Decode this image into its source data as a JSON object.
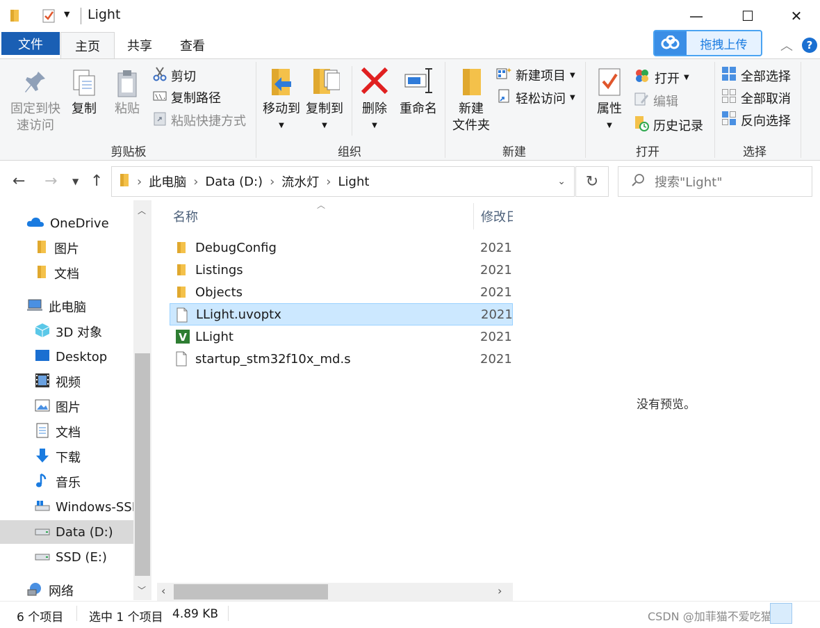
{
  "window": {
    "title": "Light",
    "minimize": "—",
    "maximize": "☐",
    "close": "✕"
  },
  "tabs": {
    "file": "文件",
    "home": "主页",
    "share": "共享",
    "view": "查看",
    "upload": "拖拽上传"
  },
  "ribbon": {
    "clipboard": {
      "pin_line1": "固定到快",
      "pin_line2": "速访问",
      "copy": "复制",
      "paste": "粘贴",
      "cut": "剪切",
      "copy_path": "复制路径",
      "paste_shortcut": "粘贴快捷方式",
      "group": "剪贴板"
    },
    "organize": {
      "move_to": "移动到",
      "copy_to": "复制到",
      "delete": "删除",
      "rename": "重命名",
      "group": "组织"
    },
    "new": {
      "new_folder_line1": "新建",
      "new_folder_line2": "文件夹",
      "new_item": "新建项目",
      "easy_access": "轻松访问",
      "group": "新建"
    },
    "open": {
      "properties": "属性",
      "open": "打开",
      "edit": "编辑",
      "history": "历史记录",
      "group": "打开"
    },
    "select": {
      "select_all": "全部选择",
      "select_none": "全部取消",
      "invert": "反向选择",
      "group": "选择"
    }
  },
  "address": {
    "path": [
      "此电脑",
      "Data (D:)",
      "流水灯",
      "Light"
    ],
    "search_placeholder": "搜索\"Light\""
  },
  "sidebar": {
    "items": [
      {
        "label": "OneDrive",
        "icon": "cloud-icon"
      },
      {
        "label": "图片",
        "icon": "folder-icon"
      },
      {
        "label": "文档",
        "icon": "folder-icon"
      },
      {
        "label": "此电脑",
        "icon": "computer-icon"
      },
      {
        "label": "3D 对象",
        "icon": "cube-icon"
      },
      {
        "label": "Desktop",
        "icon": "desktop-icon"
      },
      {
        "label": "视频",
        "icon": "film-icon"
      },
      {
        "label": "图片",
        "icon": "picture-icon"
      },
      {
        "label": "文档",
        "icon": "document-icon"
      },
      {
        "label": "下载",
        "icon": "download-icon"
      },
      {
        "label": "音乐",
        "icon": "music-icon"
      },
      {
        "label": "Windows-SSD",
        "icon": "drive-icon"
      },
      {
        "label": "Data (D:)",
        "icon": "drive-icon"
      },
      {
        "label": "SSD (E:)",
        "icon": "drive-icon"
      },
      {
        "label": "网络",
        "icon": "network-icon"
      }
    ]
  },
  "filelist": {
    "col_name": "名称",
    "col_modified": "修改日",
    "rows": [
      {
        "name": "DebugConfig",
        "date": "2021",
        "icon": "folder-icon"
      },
      {
        "name": "Listings",
        "date": "2021",
        "icon": "folder-icon"
      },
      {
        "name": "Objects",
        "date": "2021",
        "icon": "folder-icon"
      },
      {
        "name": "LLight.uvoptx",
        "date": "2021",
        "icon": "file-icon"
      },
      {
        "name": "LLight",
        "date": "2021",
        "icon": "keil-project-icon"
      },
      {
        "name": "startup_stm32f10x_md.s",
        "date": "2021",
        "icon": "file-icon"
      }
    ]
  },
  "preview": {
    "text": "没有预览。"
  },
  "status": {
    "count": "6 个项目",
    "selected": "选中 1 个项目",
    "size": "4.89 KB"
  },
  "watermark": "CSDN @加菲猫不爱吃猫粮",
  "colors": {
    "accent": "#1a5fb4",
    "selection": "#cce8ff",
    "folder": "#f4c14a"
  }
}
